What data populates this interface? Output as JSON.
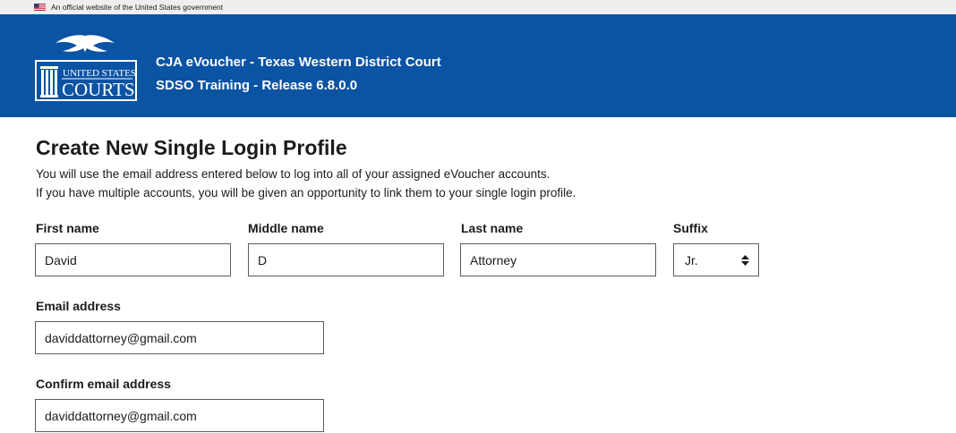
{
  "gov_banner": {
    "text": "An official website of the United States government"
  },
  "header": {
    "logo_line1": "UNITED STATES",
    "logo_line2": "COURTS",
    "title": "CJA eVoucher - Texas Western District Court",
    "subtitle": "SDSO Training - Release 6.8.0.0"
  },
  "page": {
    "title": "Create New Single Login Profile",
    "intro_line1": "You will use the email address entered below to log into all of your assigned eVoucher accounts.",
    "intro_line2": "If you have multiple accounts, you will be given an opportunity to link them to your single login profile."
  },
  "form": {
    "first_name": {
      "label": "First name",
      "value": "David"
    },
    "middle_name": {
      "label": "Middle name",
      "value": "D"
    },
    "last_name": {
      "label": "Last name",
      "value": "Attorney"
    },
    "suffix": {
      "label": "Suffix",
      "value": "Jr."
    },
    "email": {
      "label": "Email address",
      "value": "daviddattorney@gmail.com"
    },
    "confirm_email": {
      "label": "Confirm email address",
      "value": "daviddattorney@gmail.com"
    }
  },
  "icons": {
    "flag": "us-flag-icon",
    "logo": "us-courts-eagle-logo",
    "suffix_toggle": "updown-arrows-icon"
  },
  "colors": {
    "header_bg": "#0b53a3",
    "banner_bg": "#efefef",
    "input_border": "#565c65"
  }
}
